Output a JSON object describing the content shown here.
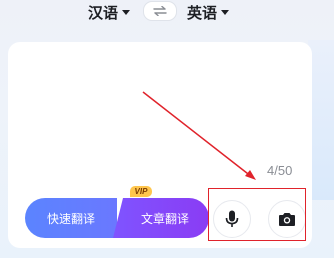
{
  "language_bar": {
    "source_language": "汉语",
    "target_language": "英语",
    "swap_icon": "swap-arrows-icon"
  },
  "input": {
    "char_counter": "4/50"
  },
  "mode_toggle": {
    "fast_label": "快速翻译",
    "article_label": "文章翻译",
    "vip_badge": "VIP"
  },
  "tools": {
    "voice_icon": "microphone-icon",
    "camera_icon": "camera-icon"
  },
  "annotation": {
    "color": "#e0232b"
  }
}
